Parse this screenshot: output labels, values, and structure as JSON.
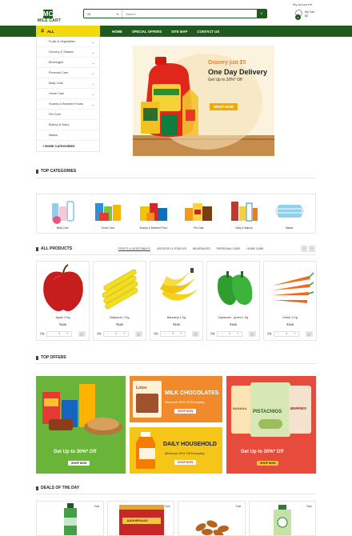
{
  "header": {
    "logo_letter": "MC",
    "logo_text": "MILE CART",
    "search_category": "All",
    "search_placeholder": "Search",
    "my_account": "My Account",
    "cart_label": "My Cart",
    "cart_amount": "$0",
    "cart_count": "0"
  },
  "nav": {
    "all_label": "ALL",
    "links": [
      "HOME",
      "SPECIAL OFFERS",
      "SITE MAP",
      "CONTACT US"
    ]
  },
  "sidebar": {
    "items": [
      {
        "label": "Fruits & Vegetables",
        "has_arrow": true
      },
      {
        "label": "Grocery & Staples",
        "has_arrow": true
      },
      {
        "label": "Beverages",
        "has_arrow": true
      },
      {
        "label": "Personal Care",
        "has_arrow": true
      },
      {
        "label": "Baby Care",
        "has_arrow": true
      },
      {
        "label": "Home Care",
        "has_arrow": true
      },
      {
        "label": "Snacks & Branded Foods",
        "has_arrow": true
      },
      {
        "label": "Pet Care",
        "has_arrow": false
      },
      {
        "label": "Bakery & Dairy",
        "has_arrow": false
      },
      {
        "label": "Masks",
        "has_arrow": false
      }
    ],
    "more": "MORE CATEGORIES"
  },
  "banner": {
    "line1": "Grocery just $5",
    "line2": "One Day Delivery",
    "line3": "Get Up to 30%* Off",
    "button": "SHOP NOW"
  },
  "top_categories": {
    "title": "TOP CATEGORIES",
    "items": [
      "Baby Care",
      "Home Care",
      "Snacks & Branded Food",
      "Pet Care",
      "Dairy & Bakery",
      "Masks"
    ]
  },
  "all_products": {
    "title": "ALL PRODUCTS",
    "tabs": [
      "FRUITS & VEGETABLES",
      "GROCERY & STAPLES",
      "BEVERAGES",
      "PERSONAL CARE",
      "HOME CARE"
    ],
    "active_tab": 0,
    "qty_label": "Qty",
    "items": [
      {
        "name": "Apple 1 Kg",
        "price": "₹100",
        "qty": "1"
      },
      {
        "name": "Babycorn 1 Kg",
        "price": "₹100",
        "qty": "1"
      },
      {
        "name": "Bannana 1 Kg",
        "price": "₹100",
        "qty": "1"
      },
      {
        "name": "Capsicum - green 1 Kg",
        "price": "₹100",
        "qty": "1"
      },
      {
        "name": "Carrot 1 Kg",
        "price": "₹100",
        "qty": "1"
      }
    ]
  },
  "top_offers": {
    "title": "TOP OFFERS",
    "left": {
      "line": "Get Up to 30%* Off",
      "button": "SHOP NOW"
    },
    "mid_top": {
      "brand": "Lotus",
      "title": "MILK CHOCOLATES",
      "sub": "Minimum 40% Off Everyday",
      "button": "SHOP NOW"
    },
    "mid_bottom": {
      "title": "DAILY HOUSEHOLD",
      "sub": "Minimum 40% Off Everyday",
      "button": "SHOP NOW"
    },
    "right": {
      "line": "Get Up to 30%* Off",
      "button": "SHOP NOW",
      "pack_labels": [
        "BANANA",
        "PISTACHIOS",
        "BERRIES"
      ]
    }
  },
  "deals": {
    "title": "DEALS OF THE DAY",
    "sale_label": "Sale",
    "card_count": 4,
    "rice_brand": "AASHIRVAAD"
  },
  "colors": {
    "brand": "#1f5b1f",
    "accent": "#f1d90b",
    "offer_green": "#6ab43a",
    "offer_orange": "#f08a2a",
    "offer_red": "#e64b3c"
  }
}
